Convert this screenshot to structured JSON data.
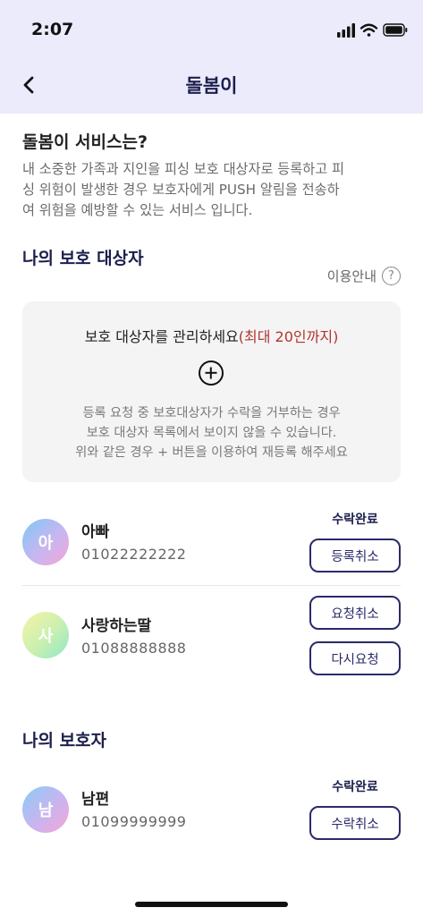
{
  "status_bar": {
    "time": "2:07"
  },
  "nav": {
    "title": "돌봄이"
  },
  "intro": {
    "title": "돌봄이 서비스는?",
    "lines": [
      "내 소중한 가족과 지인을 피싱 보호 대상자로 등록하고 피",
      "싱 위험이 발생한 경우 보호자에게 PUSH 알림을 전송하",
      "여 위험을 예방할 수 있는 서비스 입니다."
    ]
  },
  "protected": {
    "title": "나의 보호 대상자",
    "guide_label": "이용안내",
    "guide_icon": "?",
    "card": {
      "title": "보호 대상자를 관리하세요",
      "limit": "(최대 20인까지)",
      "notes": [
        "등록 요청 중 보호대상자가 수락을 거부하는 경우",
        "보호 대상자 목록에서 보이지 않을 수 있습니다.",
        "위와 같은 경우 + 버튼을 이용하여 재등록 해주세요"
      ]
    },
    "people": [
      {
        "initial": "아",
        "name": "아빠",
        "phone": "01022222222",
        "state": "수락완료",
        "buttons": [
          "등록취소"
        ]
      },
      {
        "initial": "사",
        "name": "사랑하는딸",
        "phone": "01088888888",
        "state": "",
        "buttons": [
          "요청취소",
          "다시요청"
        ]
      }
    ]
  },
  "guardians": {
    "title": "나의 보호자",
    "people": [
      {
        "initial": "남",
        "name": "남편",
        "phone": "01099999999",
        "state": "수락완료",
        "buttons": [
          "수락취소"
        ]
      }
    ]
  },
  "colors": {
    "header_bg": "#ebebfb",
    "accent": "#1c1e4d",
    "limit_red": "#b0352e"
  }
}
